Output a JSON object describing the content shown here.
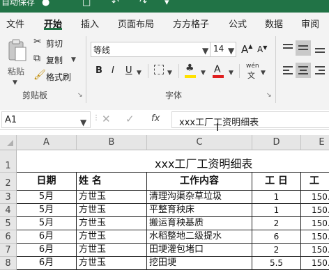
{
  "title_bar": {
    "autosave": "自动保存"
  },
  "ribbon_tabs": [
    "文件",
    "开始",
    "插入",
    "页面布局",
    "方方格子",
    "公式",
    "数据",
    "审阅"
  ],
  "clipboard": {
    "paste": "粘贴",
    "cut": "剪切",
    "copy": "复制",
    "format_painter": "格式刷",
    "group_label": "剪贴板"
  },
  "font": {
    "name": "等线",
    "size": "14",
    "bold": "B",
    "italic": "I",
    "underline": "U",
    "grow": "A",
    "shrink": "A",
    "font_color_letter": "A",
    "phonetic": "wén",
    "group_label": "字体"
  },
  "formula_bar": {
    "name_box": "A1",
    "fx": "fx",
    "content": "xxx工厂工资明细表"
  },
  "columns": [
    "A",
    "B",
    "C",
    "D",
    "E"
  ],
  "row_numbers": [
    "1",
    "2",
    "3",
    "4",
    "5",
    "6",
    "7",
    "8"
  ],
  "sheet": {
    "title": "xxx工厂工资明细表",
    "headers": [
      "日期",
      "姓 名",
      "工作内容",
      "工 日",
      "工"
    ],
    "rows": [
      [
        "5月",
        "方世玉",
        "清理沟渠杂草垃圾",
        "1",
        "150."
      ],
      [
        "5月",
        "方世玉",
        "平整育秧床",
        "1",
        "150."
      ],
      [
        "5月",
        "方世玉",
        "搬运育秧基质",
        "2",
        "150."
      ],
      [
        "6月",
        "方世玉",
        "水稻整地二级提水",
        "6",
        "150."
      ],
      [
        "6月",
        "方世玉",
        "田埂灌包堵口",
        "2",
        "150."
      ],
      [
        "6月",
        "方世玉",
        "挖田埂",
        "5.5",
        "150."
      ]
    ]
  },
  "colors": {
    "excel_green": "#217346",
    "font_color": "#e02020",
    "highlight": "#ffe100"
  }
}
